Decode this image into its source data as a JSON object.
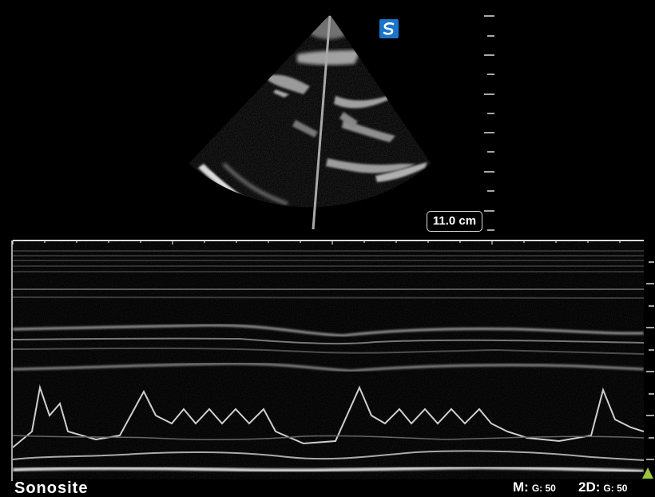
{
  "depth_label": "11.0 cm",
  "bottom_left_text": "Sonosite",
  "m_mode": {
    "label": "M:",
    "gain": "G: 50"
  },
  "two_d": {
    "label": "2D:",
    "gain": "G: 50"
  },
  "logo_icon": "sonosite-logo-icon",
  "marker_icon": "focus-triangle-icon",
  "accent_color": "#9bc53d"
}
